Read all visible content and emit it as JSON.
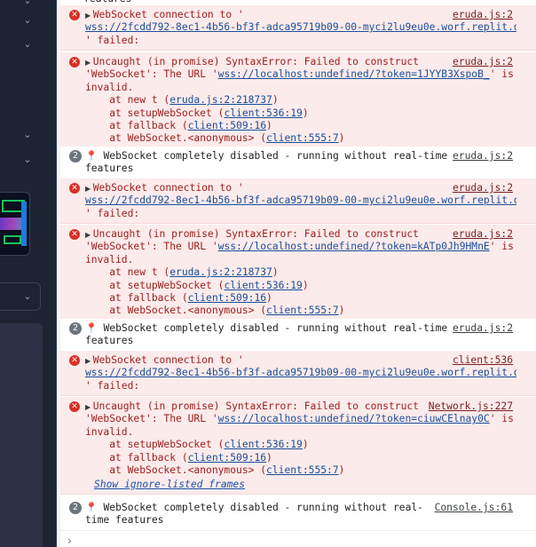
{
  "console": {
    "top_partial": "features",
    "messages": [
      {
        "type": "error",
        "source": "eruda.js:2",
        "line1": "WebSocket connection to '",
        "url": "wss://2fcdd792-8ec1-4b56-bf3f-adca95719b09-00-myci2lu9eu0e.worf.replit.d…",
        "tail": "' failed:"
      },
      {
        "type": "error",
        "source": "eruda.js:2",
        "line1": "Uncaught (in promise) SyntaxError: Failed to construct",
        "line2_prefix": "'WebSocket': The URL '",
        "line2_url": "wss://localhost:undefined/?token=1JYYB3XspoB_",
        "line2_suffix": "' is",
        "line3": "invalid.",
        "stack": [
          {
            "pre": "    at new t (",
            "link": "eruda.js:2:218737",
            "post": ")"
          },
          {
            "pre": "    at setupWebSocket (",
            "link": "client:536:19",
            "post": ")"
          },
          {
            "pre": "    at fallback (",
            "link": "client:509:16",
            "post": ")"
          },
          {
            "pre": "    at WebSocket.<anonymous> (",
            "link": "client:555:7",
            "post": ")"
          }
        ]
      },
      {
        "type": "log",
        "count": "2",
        "source": "eruda.js:2",
        "line1": " WebSocket completely disabled - running without real-time",
        "line2": "features"
      },
      {
        "type": "error",
        "source": "eruda.js:2",
        "line1": "WebSocket connection to '",
        "url": "wss://2fcdd792-8ec1-4b56-bf3f-adca95719b09-00-myci2lu9eu0e.worf.replit.d…",
        "tail": "' failed:"
      },
      {
        "type": "error",
        "source": "eruda.js:2",
        "line1": "Uncaught (in promise) SyntaxError: Failed to construct",
        "line2_prefix": "'WebSocket': The URL '",
        "line2_url": "wss://localhost:undefined/?token=kATp0Jh9HMnE",
        "line2_suffix": "' is",
        "line3": "invalid.",
        "stack": [
          {
            "pre": "    at new t (",
            "link": "eruda.js:2:218737",
            "post": ")"
          },
          {
            "pre": "    at setupWebSocket (",
            "link": "client:536:19",
            "post": ")"
          },
          {
            "pre": "    at fallback (",
            "link": "client:509:16",
            "post": ")"
          },
          {
            "pre": "    at WebSocket.<anonymous> (",
            "link": "client:555:7",
            "post": ")"
          }
        ]
      },
      {
        "type": "log",
        "count": "2",
        "source": "eruda.js:2",
        "line1": " WebSocket completely disabled - running without real-time",
        "line2": "features"
      },
      {
        "type": "error",
        "source": "client:536",
        "line1": "WebSocket connection to '",
        "url": "wss://2fcdd792-8ec1-4b56-bf3f-adca95719b09-00-myci2lu9eu0e.worf.replit.d…",
        "tail": "' failed:"
      },
      {
        "type": "error",
        "source": "Network.js:227",
        "line1": "Uncaught (in promise) SyntaxError: Failed to construct",
        "line2_prefix": "'WebSocket': The URL '",
        "line2_url": "wss://localhost:undefined/?token=ciuwCElnay0C",
        "line2_suffix": "' is",
        "line3": "invalid.",
        "stack": [
          {
            "pre": "    at setupWebSocket (",
            "link": "client:536:19",
            "post": ")"
          },
          {
            "pre": "    at fallback (",
            "link": "client:509:16",
            "post": ")"
          },
          {
            "pre": "    at WebSocket.<anonymous> (",
            "link": "client:555:7",
            "post": ")"
          }
        ],
        "ignore_frames": "Show ignore-listed frames"
      },
      {
        "type": "log",
        "count": "2",
        "source": "Console.js:61",
        "line1": " WebSocket completely disabled - running without real-",
        "line2": "time features"
      }
    ],
    "prompt": "›"
  },
  "colors": {
    "error_bg": "#fcebeb",
    "error_text": "#9e1a1a",
    "link": "#1a52b0",
    "sidebar_bg": "#1c2333"
  },
  "icons": {
    "error": "error-circle-icon",
    "pin": "pushpin-icon",
    "expand": "triangle-right-icon",
    "chevron": "chevron-down-icon"
  }
}
